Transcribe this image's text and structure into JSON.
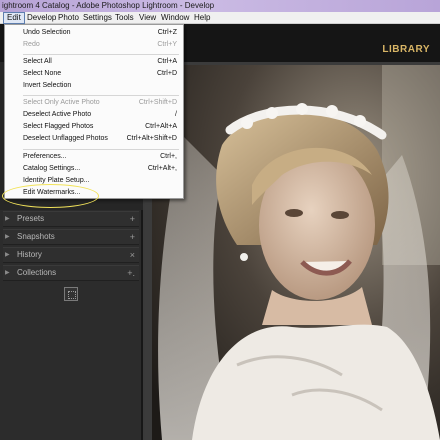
{
  "title_bar": {
    "text": "ightroom 4 Catalog - Adobe Photoshop Lightroom - Develop"
  },
  "menubar": {
    "items": [
      {
        "label": "Edit",
        "active": true
      },
      {
        "label": "Develop"
      },
      {
        "label": "Photo"
      },
      {
        "label": "Settings"
      },
      {
        "label": "Tools"
      },
      {
        "label": "View"
      },
      {
        "label": "Window"
      },
      {
        "label": "Help"
      }
    ]
  },
  "module": {
    "library_label": "LIBRARY"
  },
  "edit_menu": {
    "items": [
      {
        "label": "Undo Selection",
        "shortcut": "Ctrl+Z",
        "disabled": false
      },
      {
        "label": "Redo",
        "shortcut": "Ctrl+Y",
        "disabled": true
      },
      {
        "label": "Select All",
        "shortcut": "Ctrl+A",
        "disabled": false
      },
      {
        "label": "Select None",
        "shortcut": "Ctrl+D",
        "disabled": false
      },
      {
        "label": "Invert Selection",
        "shortcut": "",
        "disabled": false
      },
      {
        "label": "Select Only Active Photo",
        "shortcut": "Ctrl+Shift+D",
        "disabled": true
      },
      {
        "label": "Deselect Active Photo",
        "shortcut": "/",
        "disabled": false
      },
      {
        "label": "Select Flagged Photos",
        "shortcut": "Ctrl+Alt+A",
        "disabled": false
      },
      {
        "label": "Deselect Unflagged Photos",
        "shortcut": "Ctrl+Alt+Shift+D",
        "disabled": false
      },
      {
        "label": "Preferences...",
        "shortcut": "Ctrl+,",
        "disabled": false
      },
      {
        "label": "Catalog Settings...",
        "shortcut": "Ctrl+Alt+,",
        "disabled": false
      },
      {
        "label": "Identity Plate Setup...",
        "shortcut": "",
        "disabled": false
      },
      {
        "label": "Edit Watermarks...",
        "shortcut": "",
        "disabled": false,
        "highlighted": true
      }
    ]
  },
  "left_panels": [
    {
      "label": "Presets",
      "action": "+"
    },
    {
      "label": "Snapshots",
      "action": "+"
    },
    {
      "label": "History",
      "action": "×"
    },
    {
      "label": "Collections",
      "action": "+."
    }
  ],
  "colors": {
    "accent_library": "#d8b566",
    "highlight_oval": "#f2e35a",
    "title_bar": "#c3b1df"
  }
}
